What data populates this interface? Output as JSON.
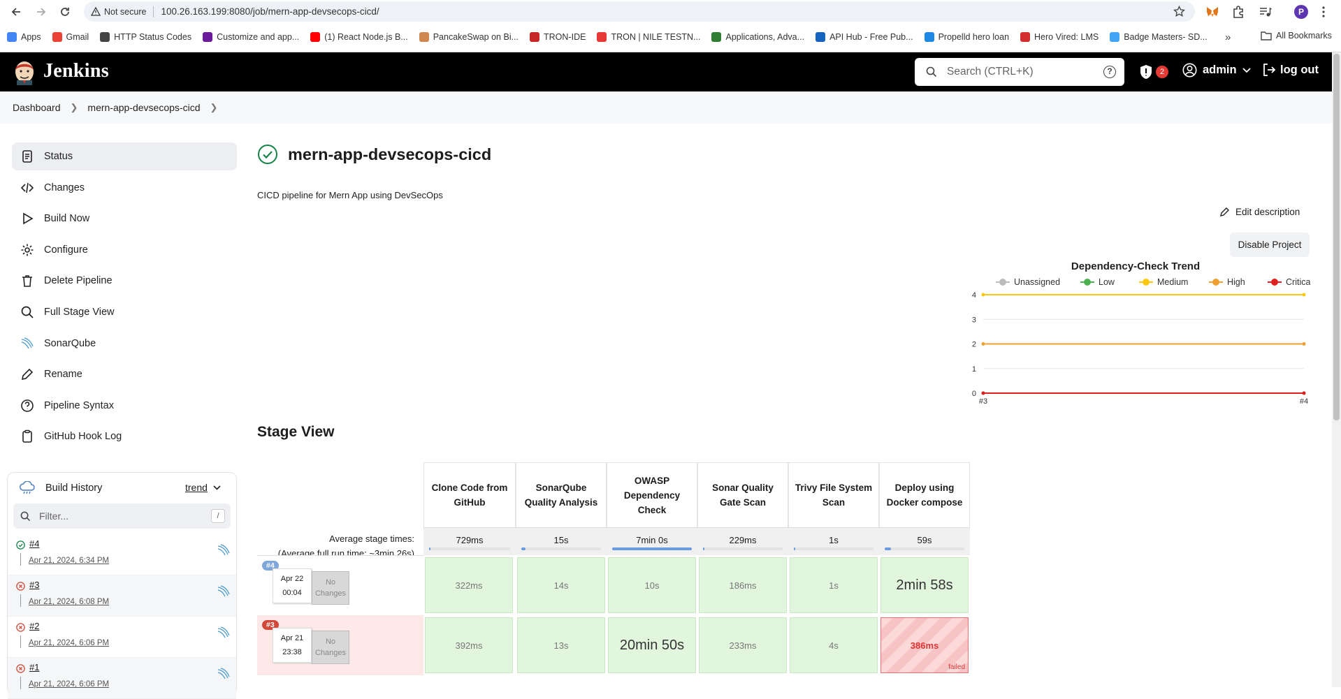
{
  "browser": {
    "url_security": "Not secure",
    "url": "100.26.163.199:8080/job/mern-app-devsecops-cicd/",
    "profile_initial": "P",
    "bookmarks": [
      {
        "label": "Apps",
        "color": "#4285f4"
      },
      {
        "label": "Gmail",
        "color": "#ea4335"
      },
      {
        "label": "HTTP Status Codes",
        "color": "#444444"
      },
      {
        "label": "Customize and app...",
        "color": "#6a1b9a"
      },
      {
        "label": "(1) React Node.js B...",
        "color": "#ff0000"
      },
      {
        "label": "PancakeSwap on Bi...",
        "color": "#d1884f"
      },
      {
        "label": "TRON-IDE",
        "color": "#c62828"
      },
      {
        "label": "TRON | NILE TESTN...",
        "color": "#e53935"
      },
      {
        "label": "Applications, Adva...",
        "color": "#2e7d32"
      },
      {
        "label": "API Hub - Free Pub...",
        "color": "#1565c0"
      },
      {
        "label": "Propelld hero loan",
        "color": "#1e88e5"
      },
      {
        "label": "Hero Vired: LMS",
        "color": "#d32f2f"
      },
      {
        "label": "Badge Masters- SD...",
        "color": "#42a5f5"
      }
    ],
    "all_bookmarks": "All Bookmarks",
    "more": "»"
  },
  "jenkins": {
    "title": "Jenkins",
    "search_placeholder": "Search (CTRL+K)",
    "help": "?",
    "security_count": "2",
    "user": "admin",
    "logout": "log out"
  },
  "breadcrumb": [
    "Dashboard",
    "mern-app-devsecops-cicd"
  ],
  "sidebar": [
    {
      "label": "Status",
      "icon": "document-icon",
      "active": true
    },
    {
      "label": "Changes",
      "icon": "code-icon"
    },
    {
      "label": "Build Now",
      "icon": "play-icon"
    },
    {
      "label": "Configure",
      "icon": "gear-icon"
    },
    {
      "label": "Delete Pipeline",
      "icon": "trash-icon"
    },
    {
      "label": "Full Stage View",
      "icon": "search-icon"
    },
    {
      "label": "SonarQube",
      "icon": "sonarqube-icon"
    },
    {
      "label": "Rename",
      "icon": "pencil-icon"
    },
    {
      "label": "Pipeline Syntax",
      "icon": "help-circle-icon"
    },
    {
      "label": "GitHub Hook Log",
      "icon": "clipboard-icon"
    }
  ],
  "build_history": {
    "title": "Build History",
    "trend": "trend",
    "filter_placeholder": "Filter...",
    "filter_shortcut": "/",
    "builds": [
      {
        "num": "#4",
        "date": "Apr 21, 2024, 6:34 PM",
        "status": "success"
      },
      {
        "num": "#3",
        "date": "Apr 21, 2024, 6:08 PM",
        "status": "failed"
      },
      {
        "num": "#2",
        "date": "Apr 21, 2024, 6:06 PM",
        "status": "failed"
      },
      {
        "num": "#1",
        "date": "Apr 21, 2024, 6:06 PM",
        "status": "failed"
      }
    ]
  },
  "project": {
    "name": "mern-app-devsecops-cicd",
    "description": "CICD pipeline for Mern App using DevSecOps",
    "edit_description": "Edit description",
    "disable_project": "Disable Project"
  },
  "chart_data": {
    "type": "line",
    "title": "Dependency-Check Trend",
    "categories": [
      "#3",
      "#4"
    ],
    "ylim": [
      0,
      4
    ],
    "yticks": [
      0,
      1,
      2,
      3,
      4
    ],
    "legend_position": "top",
    "grid": true,
    "series": [
      {
        "name": "Unassigned",
        "color": "#bbbbbb",
        "values": [
          0,
          0
        ]
      },
      {
        "name": "Low",
        "color": "#4caf50",
        "values": [
          0,
          0
        ]
      },
      {
        "name": "Medium",
        "color": "#f9c80e",
        "values": [
          4,
          4
        ]
      },
      {
        "name": "High",
        "color": "#f0a030",
        "values": [
          2,
          2
        ]
      },
      {
        "name": "Critical",
        "color": "#e02020",
        "values": [
          0,
          0
        ]
      }
    ]
  },
  "stage_view": {
    "title": "Stage View",
    "avg_label": "Average stage times:",
    "avg_runtime_prefix": "(Average ",
    "avg_runtime_link": "full",
    "avg_runtime_suffix": " run time: ~3min 26s)",
    "stages": [
      {
        "name": "Clone Code from GitHub",
        "avg": "729ms",
        "avg_fraction": 0.02
      },
      {
        "name": "SonarQube Quality Analysis",
        "avg": "15s",
        "avg_fraction": 0.05
      },
      {
        "name": "OWASP Dependency Check",
        "avg": "7min 0s",
        "avg_fraction": 1.0
      },
      {
        "name": "Sonar Quality Gate Scan",
        "avg": "229ms",
        "avg_fraction": 0.02
      },
      {
        "name": "Trivy File System Scan",
        "avg": "1s",
        "avg_fraction": 0.02
      },
      {
        "name": "Deploy using Docker compose",
        "avg": "59s",
        "avg_fraction": 0.08
      }
    ],
    "runs": [
      {
        "badge": "#4",
        "date": "Apr 22",
        "time": "00:04",
        "changes": "No Changes",
        "status": "success",
        "cells": [
          {
            "t": "322ms"
          },
          {
            "t": "14s"
          },
          {
            "t": "10s"
          },
          {
            "t": "186ms"
          },
          {
            "t": "1s"
          },
          {
            "t": "2min 58s",
            "big": true
          }
        ]
      },
      {
        "badge": "#3",
        "date": "Apr 21",
        "time": "23:38",
        "changes": "No Changes",
        "status": "failed",
        "cells": [
          {
            "t": "392ms"
          },
          {
            "t": "13s"
          },
          {
            "t": "20min 50s",
            "big": true
          },
          {
            "t": "233ms"
          },
          {
            "t": "4s"
          },
          {
            "t": "386ms",
            "fail": true,
            "flabel": "failed"
          }
        ]
      }
    ]
  }
}
